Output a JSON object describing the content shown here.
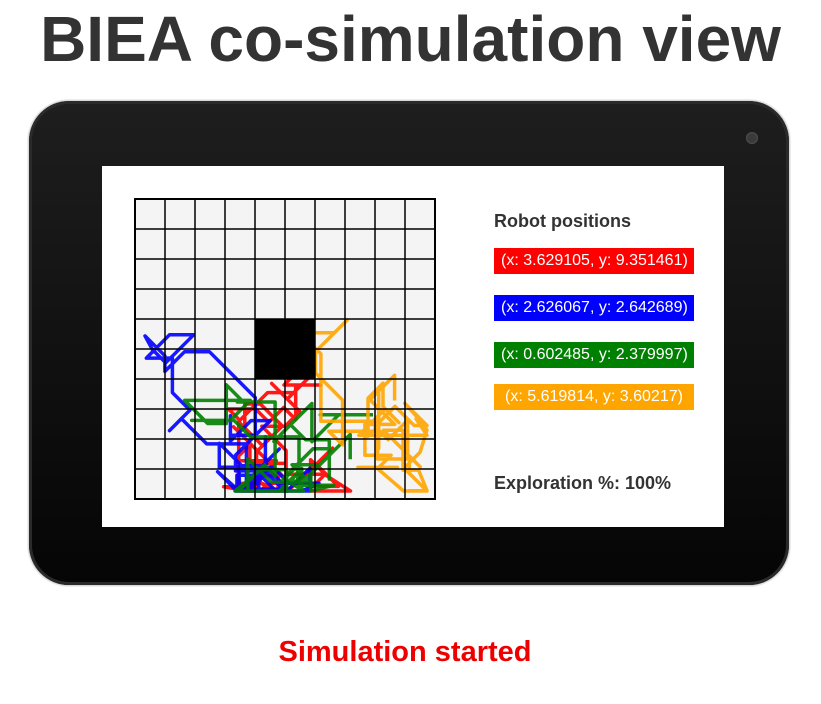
{
  "page": {
    "title": "BIEA co-simulation view",
    "status_text": "Simulation started",
    "status_color": "#ee0000"
  },
  "device": {
    "frame_color": "#111111",
    "screen_color": "#ffffff",
    "camera": "camera-dot"
  },
  "arena": {
    "grid_cells": 10,
    "obstacle": {
      "col": 4,
      "row": 4,
      "cols": 2,
      "rows": 2,
      "color": "#000000"
    },
    "trails": [
      {
        "color": "#ff0000"
      },
      {
        "color": "#0000ff"
      },
      {
        "color": "#008000"
      },
      {
        "color": "#ffa500"
      }
    ]
  },
  "panel": {
    "heading": "Robot positions",
    "robots": [
      {
        "label": "(x: 3.629105, y: 9.351461)",
        "color": "#ff0000"
      },
      {
        "label": "(x: 2.626067, y: 2.642689)",
        "color": "#0000ff"
      },
      {
        "label": "(x: 0.602485, y: 2.379997)",
        "color": "#008000"
      },
      {
        "label": "(x: 5.619814, y: 3.60217)",
        "color": "#ffa500"
      }
    ],
    "exploration_label": "Exploration %: 100%"
  }
}
